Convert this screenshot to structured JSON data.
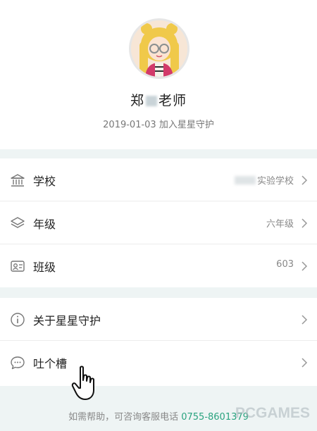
{
  "profile": {
    "name_prefix": "郑",
    "name_suffix": "老师",
    "joined": "2019-01-03 加入星星守护"
  },
  "menu_school": [
    {
      "icon": "school-building-icon",
      "label": "学校",
      "value": "实验学校"
    },
    {
      "icon": "layers-icon",
      "label": "年级",
      "value": "六年级"
    },
    {
      "icon": "class-card-icon",
      "label": "班级",
      "value": "603"
    }
  ],
  "menu_other": [
    {
      "icon": "info-icon",
      "label": "关于星星守护",
      "value": ""
    },
    {
      "icon": "chat-bubble-icon",
      "label": "吐个槽",
      "value": ""
    }
  ],
  "footer": {
    "help_text": "如需帮助，可咨询客服电话",
    "phone": "0755-8601379"
  },
  "watermark": "PCGAMES",
  "colors": {
    "accent_green": "#2aa37f",
    "section_gap": "#eef4f4"
  }
}
